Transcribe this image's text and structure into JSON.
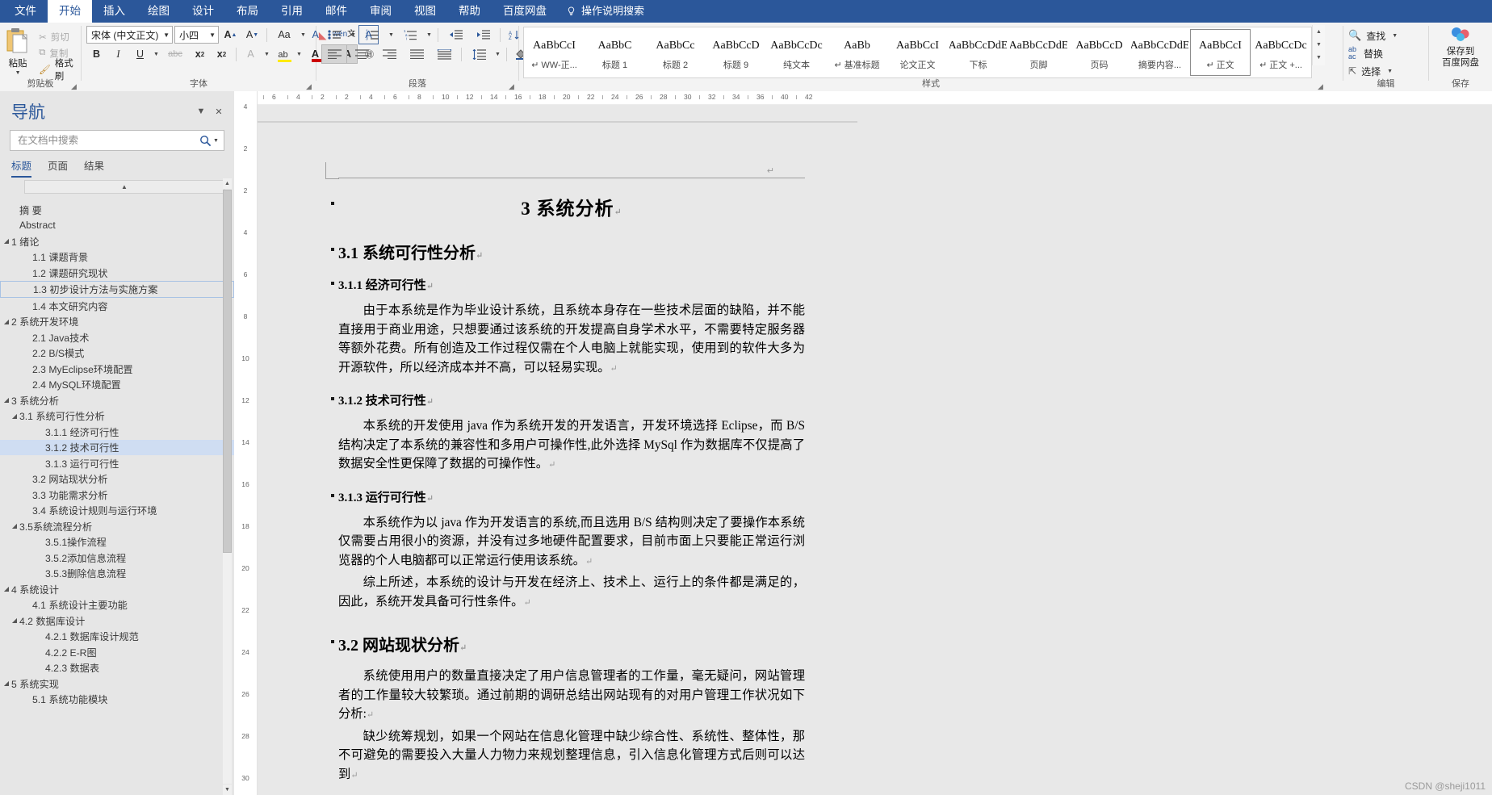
{
  "window": {
    "title": "Microsoft Word"
  },
  "ribbon": {
    "tabs": [
      {
        "label": "文件",
        "active": false
      },
      {
        "label": "开始",
        "active": true
      },
      {
        "label": "插入",
        "active": false
      },
      {
        "label": "绘图",
        "active": false
      },
      {
        "label": "设计",
        "active": false
      },
      {
        "label": "布局",
        "active": false
      },
      {
        "label": "引用",
        "active": false
      },
      {
        "label": "邮件",
        "active": false
      },
      {
        "label": "审阅",
        "active": false
      },
      {
        "label": "视图",
        "active": false
      },
      {
        "label": "帮助",
        "active": false
      },
      {
        "label": "百度网盘",
        "active": false
      }
    ],
    "tell_me": "操作说明搜索",
    "groups": {
      "clipboard": {
        "label": "剪贴板",
        "paste": "粘贴",
        "cut": "剪切",
        "copy": "复制",
        "format_painter": "格式刷"
      },
      "font": {
        "label": "字体",
        "font_name": "宋体 (中文正文)",
        "font_size": "小四",
        "grow": "A",
        "shrink": "A",
        "change_case": "Aa",
        "clear_format": "A",
        "phonetic": "文",
        "char_border": "A",
        "bold": "B",
        "italic": "I",
        "underline": "U",
        "strike": "abc",
        "subscript": "x₂",
        "superscript": "x²",
        "text_effects": "A",
        "highlight": "A",
        "font_color": "A",
        "char_shading": "A",
        "enclose": "字"
      },
      "paragraph": {
        "label": "段落"
      },
      "styles": {
        "label": "样式",
        "items": [
          {
            "preview": "AaBbCcI",
            "name": "↵ WW-正...",
            "selected": false
          },
          {
            "preview": "AaBbC",
            "name": "标题 1",
            "selected": false
          },
          {
            "preview": "AaBbCc",
            "name": "标题 2",
            "selected": false
          },
          {
            "preview": "AaBbCcD",
            "name": "标题 9",
            "selected": false
          },
          {
            "preview": "AaBbCcDc",
            "name": "纯文本",
            "selected": false
          },
          {
            "preview": "AaBb",
            "name": "↵ 基准标题",
            "selected": false
          },
          {
            "preview": "AaBbCcI",
            "name": "论文正文",
            "selected": false
          },
          {
            "preview": "AaBbCcDdE",
            "name": "下标",
            "selected": false
          },
          {
            "preview": "AaBbCcDdE",
            "name": "页脚",
            "selected": false
          },
          {
            "preview": "AaBbCcD",
            "name": "页码",
            "selected": false
          },
          {
            "preview": "AaBbCcDdE",
            "name": "摘要内容...",
            "selected": false
          },
          {
            "preview": "AaBbCcI",
            "name": "↵ 正文",
            "selected": true
          },
          {
            "preview": "AaBbCcDc",
            "name": "↵ 正文 +...",
            "selected": false
          }
        ]
      },
      "editing": {
        "label": "编辑",
        "find": "查找",
        "replace": "替换",
        "select": "选择"
      },
      "baidu": {
        "line1": "保存到",
        "line2": "百度网盘",
        "label": "保存"
      }
    }
  },
  "navigation": {
    "title": "导航",
    "search_placeholder": "在文档中搜索",
    "search_value": "",
    "tabs": [
      {
        "label": "标题",
        "active": true
      },
      {
        "label": "页面",
        "active": false
      },
      {
        "label": "结果",
        "active": false
      }
    ],
    "items": [
      {
        "label": "摘 要",
        "level": 1,
        "arrow": "",
        "state": ""
      },
      {
        "label": "Abstract",
        "level": 1,
        "arrow": "",
        "state": ""
      },
      {
        "label": "1 绪论",
        "level": 0,
        "arrow": "▲",
        "state": ""
      },
      {
        "label": "1.1 课题背景",
        "level": 2,
        "arrow": "",
        "state": ""
      },
      {
        "label": "1.2 课题研究现状",
        "level": 2,
        "arrow": "",
        "state": ""
      },
      {
        "label": "1.3 初步设计方法与实施方案",
        "level": 2,
        "arrow": "",
        "state": "outline"
      },
      {
        "label": "1.4 本文研究内容",
        "level": 2,
        "arrow": "",
        "state": ""
      },
      {
        "label": "2 系统开发环境",
        "level": 0,
        "arrow": "▲",
        "state": ""
      },
      {
        "label": "2.1 Java技术",
        "level": 2,
        "arrow": "",
        "state": ""
      },
      {
        "label": "2.2 B/S模式",
        "level": 2,
        "arrow": "",
        "state": ""
      },
      {
        "label": "2.3 MyEclipse环境配置",
        "level": 2,
        "arrow": "",
        "state": ""
      },
      {
        "label": "2.4 MySQL环境配置",
        "level": 2,
        "arrow": "",
        "state": ""
      },
      {
        "label": "3 系统分析",
        "level": 0,
        "arrow": "▲",
        "state": ""
      },
      {
        "label": "3.1 系统可行性分析",
        "level": 1,
        "arrow": "▲",
        "state": ""
      },
      {
        "label": "3.1.1 经济可行性",
        "level": 3,
        "arrow": "",
        "state": ""
      },
      {
        "label": "3.1.2 技术可行性",
        "level": 3,
        "arrow": "",
        "state": "selected"
      },
      {
        "label": "3.1.3 运行可行性",
        "level": 3,
        "arrow": "",
        "state": ""
      },
      {
        "label": "3.2 网站现状分析",
        "level": 2,
        "arrow": "",
        "state": ""
      },
      {
        "label": "3.3 功能需求分析",
        "level": 2,
        "arrow": "",
        "state": ""
      },
      {
        "label": "3.4 系统设计规则与运行环境",
        "level": 2,
        "arrow": "",
        "state": ""
      },
      {
        "label": "3.5系统流程分析",
        "level": 1,
        "arrow": "▲",
        "state": ""
      },
      {
        "label": "3.5.1操作流程",
        "level": 3,
        "arrow": "",
        "state": ""
      },
      {
        "label": "3.5.2添加信息流程",
        "level": 3,
        "arrow": "",
        "state": ""
      },
      {
        "label": "3.5.3删除信息流程",
        "level": 3,
        "arrow": "",
        "state": ""
      },
      {
        "label": "4 系统设计",
        "level": 0,
        "arrow": "▲",
        "state": ""
      },
      {
        "label": "4.1 系统设计主要功能",
        "level": 2,
        "arrow": "",
        "state": ""
      },
      {
        "label": "4.2 数据库设计",
        "level": 1,
        "arrow": "▲",
        "state": ""
      },
      {
        "label": "4.2.1 数据库设计规范",
        "level": 3,
        "arrow": "",
        "state": ""
      },
      {
        "label": "4.2.2 E-R图",
        "level": 3,
        "arrow": "",
        "state": ""
      },
      {
        "label": "4.2.3 数据表",
        "level": 3,
        "arrow": "",
        "state": ""
      },
      {
        "label": "5 系统实现",
        "level": 0,
        "arrow": "▲",
        "state": ""
      },
      {
        "label": "5.1  系统功能模块",
        "level": 2,
        "arrow": "",
        "state": ""
      }
    ]
  },
  "document": {
    "title": "3  系统分析",
    "blocks": [
      {
        "type": "h2",
        "text": "3.1  系统可行性分析"
      },
      {
        "type": "h3",
        "text": "3.1.1  经济可行性"
      },
      {
        "type": "p",
        "text": "由于本系统是作为毕业设计系统，且系统本身存在一些技术层面的缺陷，并不能直接用于商业用途，只想要通过该系统的开发提高自身学术水平，不需要特定服务器等额外花费。所有创造及工作过程仅需在个人电脑上就能实现，使用到的软件大多为开源软件，所以经济成本并不高，可以轻易实现。"
      },
      {
        "type": "h3",
        "text": "3.1.2  技术可行性"
      },
      {
        "type": "p",
        "text": "本系统的开发使用 java 作为系统开发的开发语言，开发环境选择 Eclipse，而 B/S 结构决定了本系统的兼容性和多用户可操作性,此外选择 MySql 作为数据库不仅提高了数据安全性更保障了数据的可操作性。"
      },
      {
        "type": "h3",
        "text": "3.1.3  运行可行性"
      },
      {
        "type": "p",
        "text": "本系统作为以 java 作为开发语言的系统,而且选用 B/S 结构则决定了要操作本系统仅需要占用很小的资源，并没有过多地硬件配置要求，目前市面上只要能正常运行浏览器的个人电脑都可以正常运行使用该系统。"
      },
      {
        "type": "p",
        "text": "综上所述，本系统的设计与开发在经济上、技术上、运行上的条件都是满足的，因此，系统开发具备可行性条件。"
      },
      {
        "type": "h2",
        "text": "3.2  网站现状分析"
      },
      {
        "type": "p",
        "text": "系统使用用户的数量直接决定了用户信息管理者的工作量，毫无疑问，网站管理者的工作量较大较繁琐。通过前期的调研总结出网站现有的对用户管理工作状况如下分析:"
      },
      {
        "type": "p",
        "text": "缺少统筹规划，如果一个网站在信息化管理中缺少综合性、系统性、整体性，那不可避免的需要投入大量人力物力来规划整理信息，引入信息化管理方式后则可以达到"
      }
    ]
  },
  "ruler": {
    "horizontal_marks": [
      "6",
      "4",
      "2",
      "2",
      "4",
      "6",
      "8",
      "10",
      "12",
      "14",
      "16",
      "18",
      "20",
      "22",
      "24",
      "26",
      "28",
      "30",
      "32",
      "34",
      "36",
      "40",
      "42"
    ],
    "vertical_marks": [
      "4",
      "2",
      "2",
      "4",
      "6",
      "8",
      "10",
      "12",
      "14",
      "16",
      "18",
      "20",
      "22",
      "24",
      "26",
      "28",
      "30"
    ]
  },
  "watermark": "CSDN @sheji1011",
  "colors": {
    "ribbon_blue": "#2b579a",
    "nav_bg": "#e6e6e6",
    "selection_blue": "#cfddf2",
    "accent": "#2b579a",
    "doc_bg": "#e8e8e8"
  }
}
